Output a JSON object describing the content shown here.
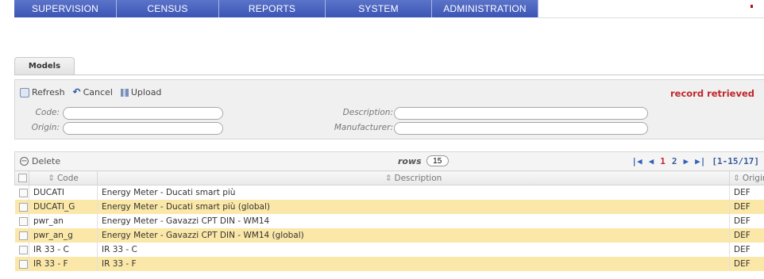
{
  "nav": {
    "tabs": [
      "SUPERVISION",
      "CENSUS",
      "REPORTS",
      "SYSTEM",
      "ADMINISTRATION"
    ]
  },
  "tab": {
    "label": "Models"
  },
  "toolbar": {
    "refresh": "Refresh",
    "cancel": "Cancel",
    "upload": "Upload",
    "status": "record retrieved"
  },
  "filters": {
    "code_label": "Code:",
    "origin_label": "Origin:",
    "description_label": "Description:",
    "manufacturer_label": "Manufacturer:",
    "code_value": "",
    "origin_value": "",
    "description_value": "",
    "manufacturer_value": ""
  },
  "grid": {
    "delete_label": "Delete",
    "rows_label": "rows",
    "rows_value": "15",
    "pages": [
      "1",
      "2"
    ],
    "range": "[1-15/17]",
    "columns": [
      "Code",
      "Description",
      "Origin"
    ],
    "rows": [
      {
        "code": "DUCATI",
        "description": "Energy Meter - Ducati smart più",
        "origin": "DEF"
      },
      {
        "code": "DUCATI_G",
        "description": "Energy Meter - Ducati smart più (global)",
        "origin": "DEF"
      },
      {
        "code": "pwr_an",
        "description": "Energy Meter - Gavazzi CPT DIN - WM14",
        "origin": "DEF"
      },
      {
        "code": "pwr_an_g",
        "description": "Energy Meter - Gavazzi CPT DIN - WM14 (global)",
        "origin": "DEF"
      },
      {
        "code": "IR 33 - C",
        "description": "IR 33 - C",
        "origin": "DEF"
      },
      {
        "code": "IR 33 - F",
        "description": "IR 33 - F",
        "origin": "DEF"
      }
    ]
  },
  "colors": {
    "nav_bg": "#3c55b5",
    "row_highlight": "#fbe8a8",
    "status": "#c0272d",
    "current_page": "#c0272d"
  },
  "icons": [
    "refresh-icon",
    "cancel-icon",
    "upload-icon",
    "minus-circle-icon",
    "first-page-icon",
    "prev-page-icon",
    "next-page-icon",
    "last-page-icon",
    "sort-icon"
  ]
}
